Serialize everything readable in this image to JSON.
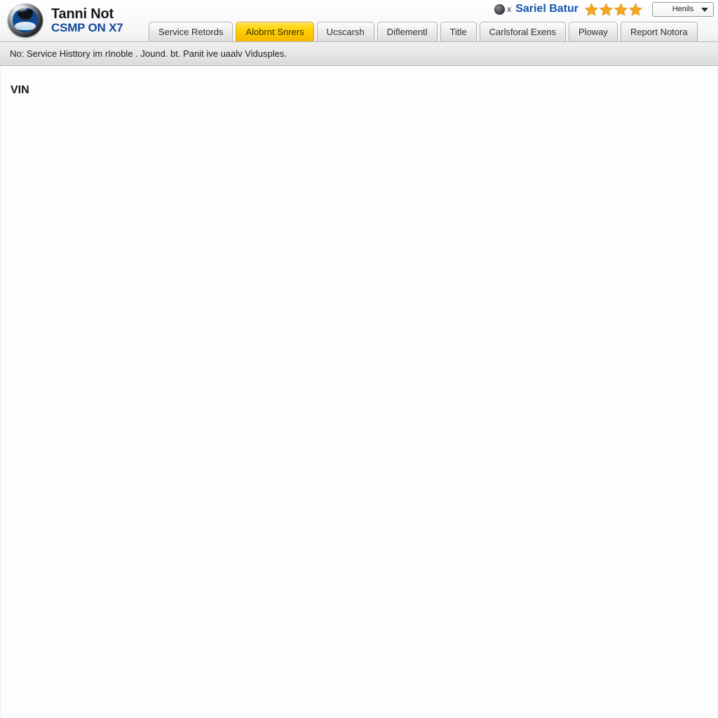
{
  "brand": {
    "emblem_icon": "car-wheel-emblem-icon",
    "line1": "Tanni Not",
    "line2": "CSMP ON X7",
    "accent_blue": "#11489e"
  },
  "account": {
    "avatar_icon": "user-avatar-icon",
    "separator": "x",
    "name": "Sariel Batur",
    "name_color": "#1257b0",
    "rating_stars": 4,
    "star_color": "#f5a623",
    "dropdown": {
      "value": "Henils",
      "caret_icon": "chevron-down-icon"
    }
  },
  "tabs": [
    {
      "label": "Service Retords",
      "active": false
    },
    {
      "label": "Alobrnt Snrers",
      "active": true
    },
    {
      "label": "Ucscarsh",
      "active": false
    },
    {
      "label": "Diflementl",
      "active": false
    },
    {
      "label": "Title",
      "active": false
    },
    {
      "label": "Carlsforal Exens",
      "active": false
    },
    {
      "label": "Ploway",
      "active": false
    },
    {
      "label": "Report Notora",
      "active": false
    }
  ],
  "active_tab_color": "#ffd000",
  "message_bar": {
    "text": "No: Service Histtory im rInoble . Jound. bt. Panit ive uaalv Vidusples."
  },
  "content": {
    "vin_label": "VIN"
  }
}
